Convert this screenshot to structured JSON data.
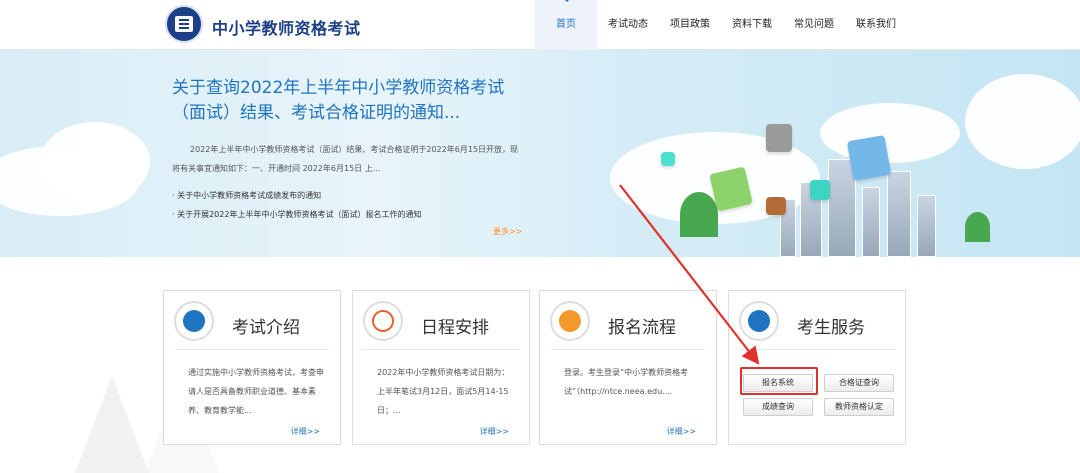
{
  "header": {
    "brand": "中小学教师资格考试",
    "nav": [
      "首页",
      "考试动态",
      "项目政策",
      "资料下载",
      "常见问题",
      "联系我们"
    ]
  },
  "banner": {
    "title": "关于查询2022年上半年中小学教师资格考试（面试）结果、考试合格证明的通知...",
    "desc": "2022年上半年中小学教师资格考试（面试）结果、考试合格证明于2022年6月15日开放，现将有关事宜通知如下：一、开通时间 2022年6月15日 上...",
    "links": [
      "关于中小学教师资格考试成绩发布的通知",
      "关于开展2022年上半年中小学教师资格考试（面试）报名工作的通知"
    ],
    "more": "更多>>"
  },
  "cards": [
    {
      "title": "考试介绍",
      "text": "通过实施中小学教师资格考试，考查申请人是否具备教师职业道德、基本素养、教育教学能...",
      "detail": "详细>>"
    },
    {
      "title": "日程安排",
      "text": "2022年中小学教师资格考试日期为：上半年笔试3月12日，面试5月14-15日；...",
      "detail": "详细>>"
    },
    {
      "title": "报名流程",
      "text": "登录。考生登录“中小学教师资格考试”（http://ntce.neea.edu....",
      "detail": "详细>>"
    },
    {
      "title": "考生服务",
      "buttons": [
        "报名系统",
        "合格证查询",
        "成绩查询",
        "教师资格认定"
      ]
    }
  ],
  "colors": {
    "primary": "#1f74c1",
    "accent": "#ff8c1a",
    "highlight": "#e0312d"
  }
}
